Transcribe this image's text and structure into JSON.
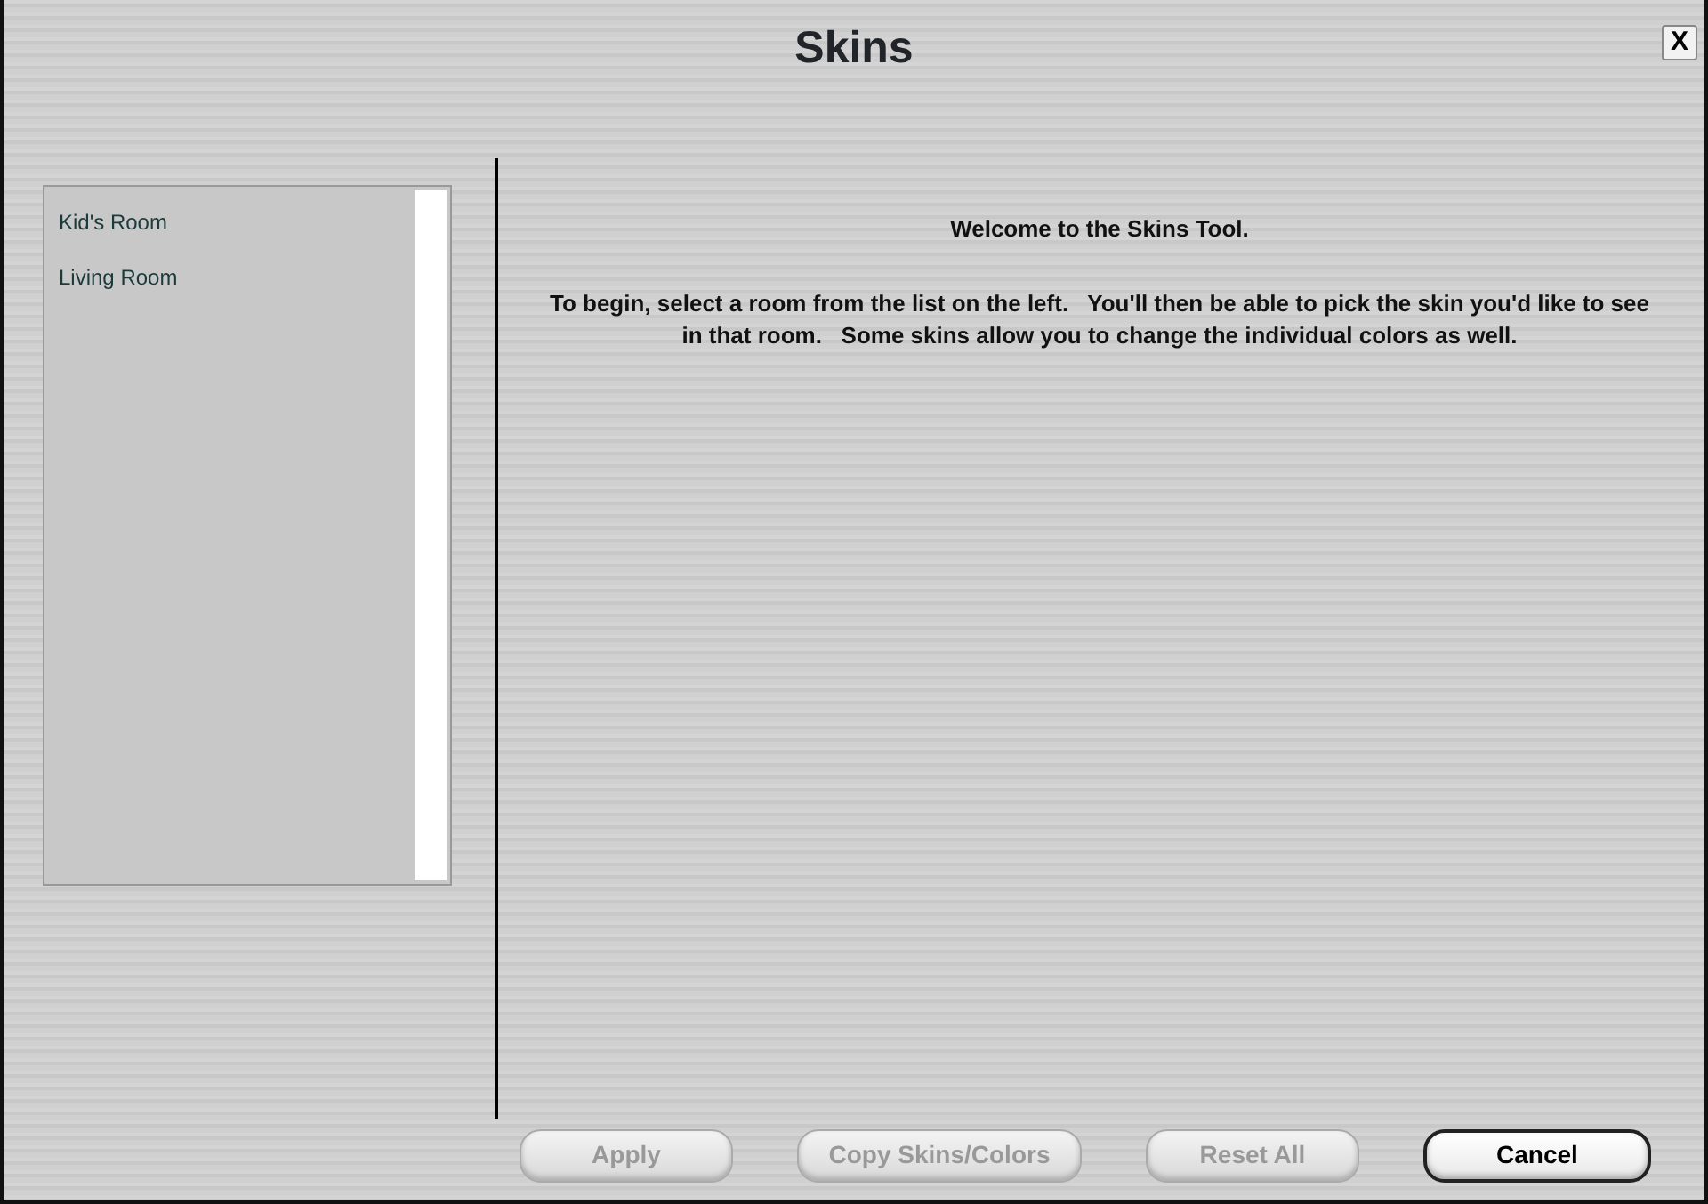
{
  "window": {
    "title": "Skins",
    "close": "X"
  },
  "rooms": [
    {
      "label": "Kid's Room",
      "selected": false
    },
    {
      "label": "Living Room",
      "selected": false
    }
  ],
  "content": {
    "heading": "Welcome to the Skins Tool.",
    "body": "To begin, select a room from the list on the left.   You'll then be able to pick the skin you'd like to see in that room.   Some skins allow you to change the individual colors as well."
  },
  "buttons": [
    {
      "label": "Apply",
      "disabled": true
    },
    {
      "label": "Copy Skins/Colors",
      "disabled": true
    },
    {
      "label": "Reset All",
      "disabled": true
    },
    {
      "label": "Cancel",
      "disabled": false
    }
  ]
}
